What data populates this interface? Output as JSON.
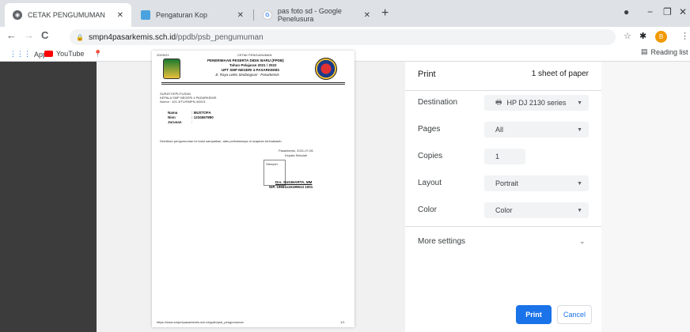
{
  "tabs": [
    {
      "label": "CETAK PENGUMUMAN",
      "icon": "globe-icon",
      "active": true
    },
    {
      "label": "Pengaturan Kop",
      "icon": "page-icon",
      "active": false
    },
    {
      "label": "pas foto sd - Google Penelusura",
      "icon": "google-icon",
      "active": false
    }
  ],
  "address": {
    "host": "smpn4pasarkemis.sch.id",
    "path": "/ppdb/psb_pengumuman"
  },
  "bookmarks": [
    {
      "label": "Apps",
      "icon": "apps-grid-icon"
    },
    {
      "label": "YouTube",
      "icon": "youtube-icon"
    }
  ],
  "reading_list": "Reading list",
  "avatar_letter": "B",
  "document": {
    "header_line1": "PENERIMAAN PESERTA DIDIK BARU (PPDB)",
    "header_line2": "Tahun Pelajaran 2021 / 2022",
    "header_line3": "UPT SMP NEGERI 4 PASARKEMIS",
    "header_line4": "Jl. Raya Leles Sindangsari - Pasarkemis",
    "top_left": "20/09/21",
    "top_center": "CETAK PENGUMUMAN",
    "sk_title": "SURAT KEPUTUSAN",
    "sk_line2": "KEPALA SMP NEGERI 4 PASARKEMIS",
    "sk_number": "Nomor : 421.3/TU/SMPN.4/2021",
    "name_label": "Nama",
    "name_value": ": MUSTOFA",
    "nisn_label": "Nisn",
    "nisn_value": ": 1234567890",
    "jurusan_label": "Jurusan",
    "jurusan_value": ":",
    "statement": "Demikian pengumuman ini kami sampaikan, atas perhatiannya di ucapkan terimakasih.",
    "place_date": "Pasarkemis, 2021-07-06",
    "position": "Kepala Sekolah",
    "stamp_label": "Stempel",
    "signer": "Drs. SUGIHARTA, MM",
    "nip": "NIP. 19661115199613 1001",
    "footer_url": "https://www.smpn4pasarkemis.sch.id/ppdb/psb_pengumuman",
    "page_count": "1/1"
  },
  "print_panel": {
    "title": "Print",
    "sheets": "1 sheet of paper",
    "destination_label": "Destination",
    "destination_value": "HP DJ 2130 series",
    "pages_label": "Pages",
    "pages_value": "All",
    "copies_label": "Copies",
    "copies_value": "1",
    "layout_label": "Layout",
    "layout_value": "Portrait",
    "color_label": "Color",
    "color_value": "Color",
    "more_settings": "More settings",
    "print_button": "Print",
    "cancel_button": "Cancel"
  },
  "colors": {
    "accent": "#1a73e8",
    "youtube": "#ff0000"
  }
}
